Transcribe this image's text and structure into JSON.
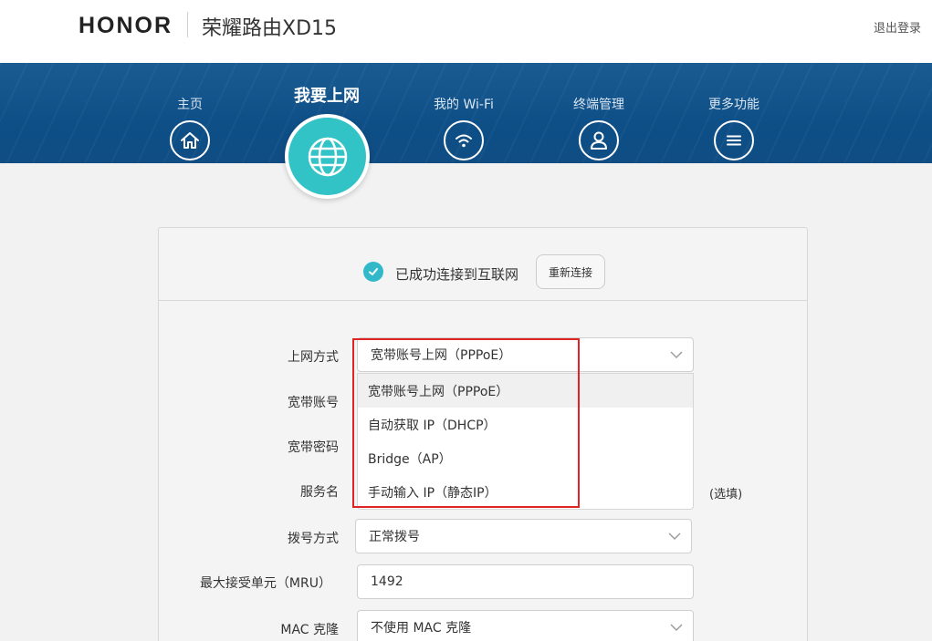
{
  "header": {
    "brand": "HONOR",
    "product_title": "荣耀路由XD15",
    "logout_label": "退出登录"
  },
  "nav": {
    "items": [
      {
        "label": "主页",
        "icon": "home-icon"
      },
      {
        "label": "我要上网",
        "icon": "globe-icon",
        "active": true
      },
      {
        "label": "我的 Wi-Fi",
        "icon": "wifi-icon"
      },
      {
        "label": "终端管理",
        "icon": "user-icon"
      },
      {
        "label": "更多功能",
        "icon": "menu-icon"
      }
    ]
  },
  "status": {
    "text": "已成功连接到互联网",
    "reconnect_label": "重新连接",
    "icon": "check-circle-icon"
  },
  "form": {
    "connection_type": {
      "label": "上网方式",
      "value": "宽带账号上网（PPPoE）"
    },
    "account": {
      "label": "宽带账号"
    },
    "password": {
      "label": "宽带密码"
    },
    "service_name": {
      "label": "服务名",
      "hint": "(选填)"
    },
    "dial_mode": {
      "label": "拨号方式",
      "value": "正常拨号"
    },
    "mru": {
      "label": "最大接受单元（MRU）",
      "value": "1492"
    },
    "mac_clone": {
      "label": "MAC 克隆",
      "value": "不使用 MAC 克隆"
    }
  },
  "dropdown": {
    "options": [
      "宽带账号上网（PPPoE）",
      "自动获取 IP（DHCP）",
      "Bridge（AP）",
      "手动输入 IP（静态IP）"
    ],
    "selected_index": 0
  },
  "colors": {
    "nav_bg": "#0f4d83",
    "accent_teal": "#32c3c7",
    "highlight_red": "#e02424"
  }
}
